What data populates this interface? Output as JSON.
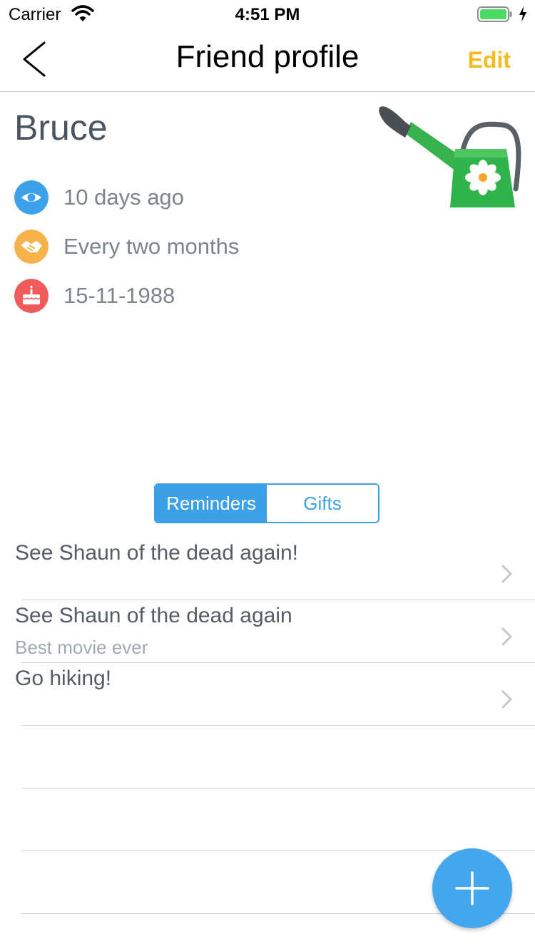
{
  "status_bar": {
    "carrier": "Carrier",
    "time": "4:51 PM"
  },
  "nav": {
    "title": "Friend profile",
    "edit_label": "Edit"
  },
  "profile": {
    "name": "Bruce",
    "last_seen": "10 days ago",
    "frequency": "Every two months",
    "birthday": "15-11-1988",
    "icons": {
      "last_seen": "eye-icon",
      "frequency": "handshake-icon",
      "birthday": "cake-icon",
      "avatar": "watering-can-icon"
    },
    "colors": {
      "eye": "#3ca1e8",
      "handshake": "#f7b24a",
      "cake": "#ef5a5a"
    }
  },
  "segments": {
    "reminders": "Reminders",
    "gifts": "Gifts",
    "selected": "Reminders"
  },
  "reminders": [
    {
      "title": "See Shaun of the dead again!",
      "subtitle": ""
    },
    {
      "title": "See Shaun of the dead again",
      "subtitle": "Best movie ever"
    },
    {
      "title": "Go hiking!",
      "subtitle": ""
    }
  ],
  "fab": {
    "icon": "plus-icon"
  },
  "colors": {
    "accent": "#3ba0e6",
    "edit": "#f5bc1c"
  }
}
